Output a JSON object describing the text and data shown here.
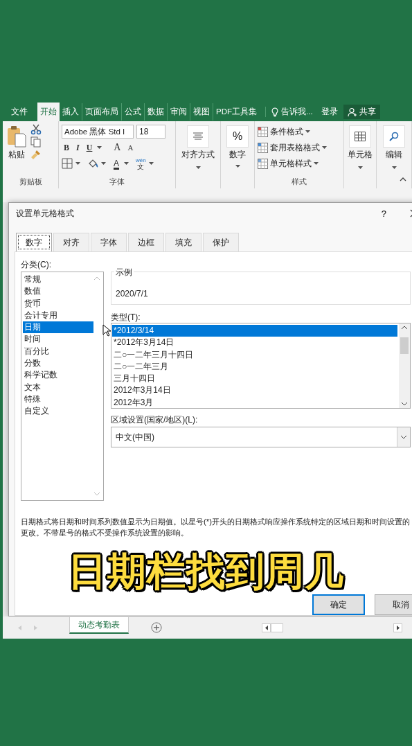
{
  "menu_tabs": [
    {
      "label": "文件",
      "selected": false
    },
    {
      "label": "开始",
      "selected": true
    },
    {
      "label": "插入",
      "selected": false
    },
    {
      "label": "页面布局",
      "selected": false
    },
    {
      "label": "公式",
      "selected": false
    },
    {
      "label": "数据",
      "selected": false
    },
    {
      "label": "审阅",
      "selected": false
    },
    {
      "label": "视图",
      "selected": false
    },
    {
      "label": "PDF工具集",
      "selected": false
    }
  ],
  "tell_me": "告诉我...",
  "sign_in": "登录",
  "share": "共享",
  "ribbon": {
    "clipboard": {
      "paste": "粘贴",
      "group": "剪贴板"
    },
    "font": {
      "name": "Adobe 黑体 Std I",
      "size": "18",
      "bold": "B",
      "italic": "I",
      "underline": "U",
      "grow": "A",
      "shrink": "A",
      "font_color": "A",
      "phonetic_top": "wén",
      "phonetic_bottom": "文",
      "group": "字体"
    },
    "alignment": "对齐方式",
    "number": "数字",
    "number_symbol": "%",
    "styles": {
      "items": [
        "条件格式",
        "套用表格格式",
        "单元格样式"
      ],
      "group": "样式"
    },
    "cells": "单元格",
    "editing": "编辑"
  },
  "dialog": {
    "title": "设置单元格格式",
    "help": "?",
    "tabs": [
      {
        "label": "数字",
        "selected": true
      },
      {
        "label": "对齐",
        "selected": false
      },
      {
        "label": "字体",
        "selected": false
      },
      {
        "label": "边框",
        "selected": false
      },
      {
        "label": "填充",
        "selected": false
      },
      {
        "label": "保护",
        "selected": false
      }
    ],
    "category_label": "分类(C):",
    "categories": [
      {
        "label": "常规",
        "selected": false
      },
      {
        "label": "数值",
        "selected": false
      },
      {
        "label": "货币",
        "selected": false
      },
      {
        "label": "会计专用",
        "selected": false
      },
      {
        "label": "日期",
        "selected": true
      },
      {
        "label": "时间",
        "selected": false
      },
      {
        "label": "百分比",
        "selected": false
      },
      {
        "label": "分数",
        "selected": false
      },
      {
        "label": "科学记数",
        "selected": false
      },
      {
        "label": "文本",
        "selected": false
      },
      {
        "label": "特殊",
        "selected": false
      },
      {
        "label": "自定义",
        "selected": false
      }
    ],
    "sample_label": "示例",
    "sample": "2020/7/1",
    "type_label": "类型(T):",
    "types": [
      {
        "label": "*2012/3/14",
        "selected": true
      },
      {
        "label": "*2012年3月14日",
        "selected": false
      },
      {
        "label": "二○一二年三月十四日",
        "selected": false
      },
      {
        "label": "二○一二年三月",
        "selected": false
      },
      {
        "label": "三月十四日",
        "selected": false
      },
      {
        "label": "2012年3月14日",
        "selected": false
      },
      {
        "label": "2012年3月",
        "selected": false
      }
    ],
    "locale_label": "区域设置(国家/地区)(L):",
    "locale": "中文(中国)",
    "description": "日期格式将日期和时间系列数值显示为日期值。以星号(*)开头的日期格式响应操作系统特定的区域日期和时间设置的更改。不带星号的格式不受操作系统设置的影响。",
    "ok": "确定",
    "cancel": "取消"
  },
  "sheets": [
    {
      "label": "动态考勤表",
      "selected": true
    }
  ],
  "caption": "日期栏找到周几"
}
